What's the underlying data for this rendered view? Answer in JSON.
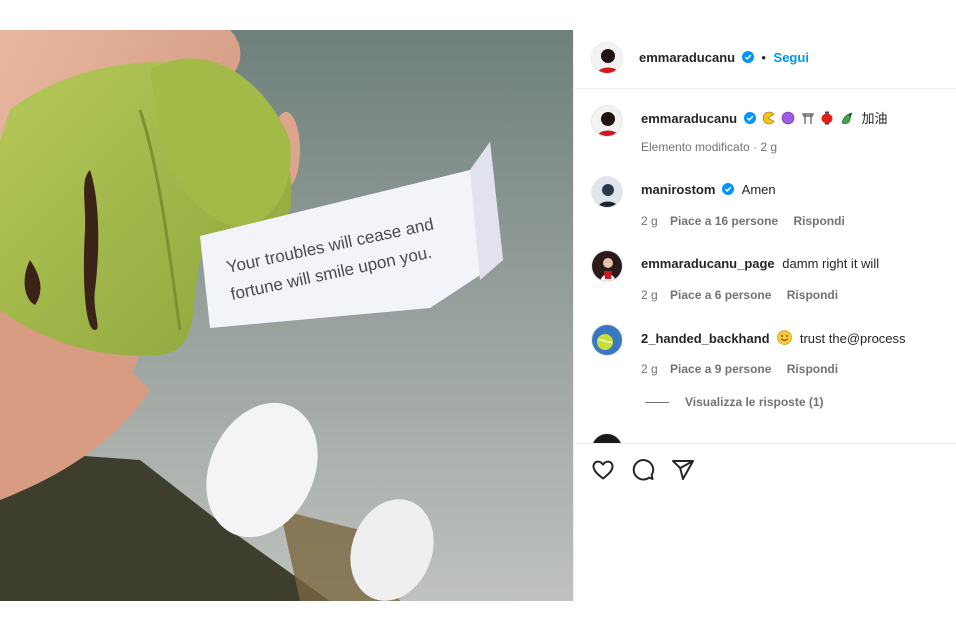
{
  "post": {
    "author": "emmaraducanu",
    "follow_label": "Segui",
    "dot": "•",
    "fortune_line1": "Your troubles will cease and",
    "fortune_line2": "fortune will smile upon you."
  },
  "caption": {
    "username": "emmaraducanu",
    "emojis": [
      "pacman",
      "purple-circle",
      "torii-gate",
      "red-lantern",
      "dragon"
    ],
    "text": "加油",
    "meta": "Elemento modificato · 2 g"
  },
  "comments": [
    {
      "username": "manirostom",
      "verified": true,
      "text": "Amen",
      "time": "2 g",
      "likes": "Piace a 16 persone",
      "reply": "Rispondi"
    },
    {
      "username": "emmaraducanu_page",
      "verified": false,
      "text": "damm right it will",
      "time": "2 g",
      "likes": "Piace a 6 persone",
      "reply": "Rispondi"
    },
    {
      "username": "2_handed_backhand",
      "verified": false,
      "text": "trust the@process",
      "emoji": "smiling-face",
      "time": "2 g",
      "likes": "Piace a 9 persone",
      "reply": "Rispondi",
      "view_replies": "Visualizza le risposte (1)"
    }
  ],
  "colors": {
    "accent": "#0095f6",
    "verified": "#0095f6",
    "muted": "#737373",
    "text": "#262626"
  },
  "icons": [
    "heart-icon",
    "comment-icon",
    "share-icon",
    "verified-badge-icon"
  ]
}
